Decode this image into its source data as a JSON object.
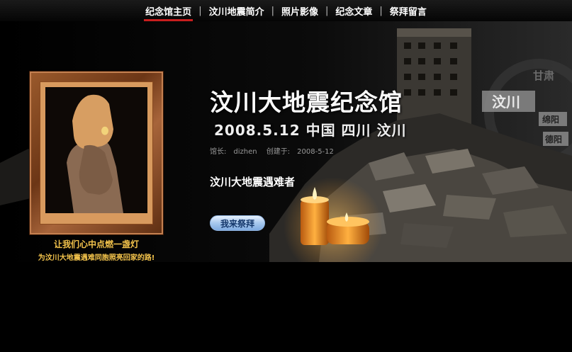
{
  "nav": {
    "items": [
      {
        "label": "纪念馆主页",
        "active": true
      },
      {
        "label": "汶川地震简介",
        "active": false
      },
      {
        "label": "照片影像",
        "active": false
      },
      {
        "label": "纪念文章",
        "active": false
      },
      {
        "label": "祭拜留言",
        "active": false
      }
    ],
    "separator": "|"
  },
  "frame": {
    "caption_line1": "让我们心中点燃一盏灯",
    "caption_line2": "为汶川大地震遇难同胞照亮回家的路!"
  },
  "hero": {
    "title": "汶川大地震纪念馆",
    "subtitle": "2008.5.12  中国 四川 汶川",
    "curator_label": "馆长:",
    "curator_name": "dizhen",
    "created_label": "创建于:",
    "created_date": "2008-5-12",
    "victims_title": "汶川大地震遇难者",
    "worship_button": "我来祭拜"
  },
  "map_labels": {
    "gansu": "甘肃",
    "wenchuan": "汶川",
    "mianyang": "绵阳",
    "deyang": "德阳"
  },
  "colors": {
    "nav_active_underline": "#c81e1e",
    "caption_text": "#f4c44c",
    "button_blue": "#a7c8ee"
  }
}
